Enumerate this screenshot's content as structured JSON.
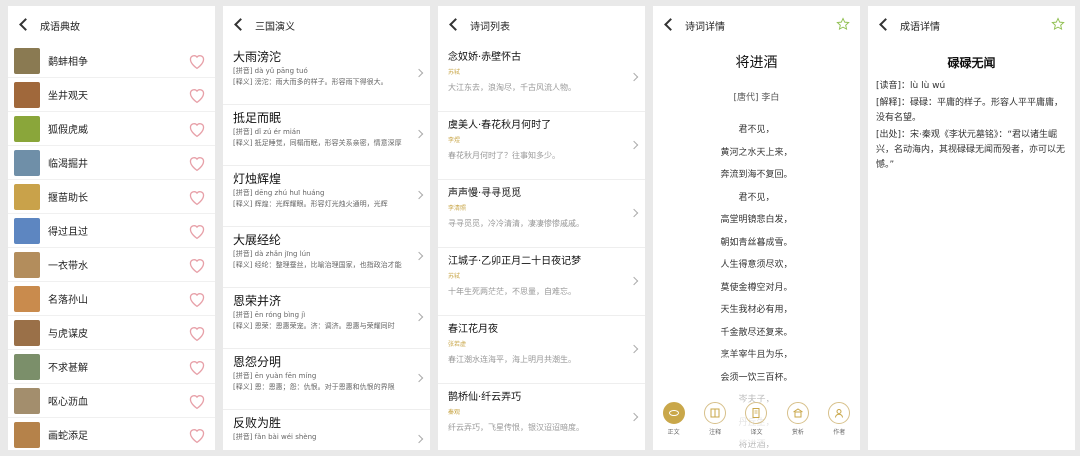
{
  "panel1": {
    "title": "成语典故",
    "items": [
      {
        "name": "鹬蚌相争",
        "color": "#8a7a52"
      },
      {
        "name": "坐井观天",
        "color": "#a0683b"
      },
      {
        "name": "狐假虎威",
        "color": "#8aa63a"
      },
      {
        "name": "临渴掘井",
        "color": "#6f8fa8"
      },
      {
        "name": "揠苗助长",
        "color": "#c9a24a"
      },
      {
        "name": "得过且过",
        "color": "#5d86c1"
      },
      {
        "name": "一衣带水",
        "color": "#b38d5c"
      },
      {
        "name": "名落孙山",
        "color": "#c98b4d"
      },
      {
        "name": "与虎谋皮",
        "color": "#9a7048"
      },
      {
        "name": "不求甚解",
        "color": "#7b8f6a"
      },
      {
        "name": "呕心沥血",
        "color": "#a38e6d"
      },
      {
        "name": "画蛇添足",
        "color": "#b5824a"
      }
    ]
  },
  "panel2": {
    "title": "三国演义",
    "items": [
      {
        "title": "大雨滂沱",
        "pinyin": "[拼音] dà yǔ pāng tuó",
        "meaning": "[释义] 滂沱：雨大而多的样子。形容雨下得很大。"
      },
      {
        "title": "抵足而眠",
        "pinyin": "[拼音] dǐ zú ér mián",
        "meaning": "[释义] 抵足睡觉，同榻而眠，形容关系亲密，情意深厚"
      },
      {
        "title": "灯烛辉煌",
        "pinyin": "[拼音] dēng zhú huī huáng",
        "meaning": "[释义] 辉煌：光辉耀眼。形容灯光烛火通明，光辉"
      },
      {
        "title": "大展经纶",
        "pinyin": "[拼音] dà zhǎn jīng lún",
        "meaning": "[释义] 经纶：整理蚕丝，比喻治理国家，也指政治才能"
      },
      {
        "title": "恩荣并济",
        "pinyin": "[拼音] ēn róng bìng jì",
        "meaning": "[释义] 恩荣：恩惠荣宠。济：调济。恩惠与荣耀同时"
      },
      {
        "title": "恩怨分明",
        "pinyin": "[拼音] ēn yuàn fēn míng",
        "meaning": "[释义] 恩：恩惠；怨：仇恨。对于恩惠和仇恨的界限"
      },
      {
        "title": "反败为胜",
        "pinyin": "[拼音] fǎn bài wéi shèng",
        "meaning": ""
      }
    ]
  },
  "panel3": {
    "title": "诗词列表",
    "items": [
      {
        "title": "念奴娇·赤壁怀古",
        "tag": "苏轼",
        "line": "大江东去，浪淘尽，千古风流人物。"
      },
      {
        "title": "虞美人·春花秋月何时了",
        "tag": "李煜",
        "line": "春花秋月何时了？往事知多少。"
      },
      {
        "title": "声声慢·寻寻觅觅",
        "tag": "李清照",
        "line": "寻寻觅觅，冷冷清清，凄凄惨惨戚戚。"
      },
      {
        "title": "江城子·乙卯正月二十日夜记梦",
        "tag": "苏轼",
        "line": "十年生死两茫茫，不思量，自难忘。"
      },
      {
        "title": "春江花月夜",
        "tag": "张若虚",
        "line": "春江潮水连海平，海上明月共潮生。"
      },
      {
        "title": "鹊桥仙·纤云弄巧",
        "tag": "秦观",
        "line": "纤云弄巧，飞星传恨，银汉迢迢暗度。"
      }
    ]
  },
  "panel4": {
    "title": "诗词详情",
    "poem_title": "将进酒",
    "author": "[唐代] 李白",
    "verses": [
      "君不见，",
      "黄河之水天上来，",
      "奔流到海不复回。",
      "君不见，",
      "高堂明镜悲白发，",
      "朝如青丝暮成雪。",
      "人生得意须尽欢，",
      "莫使金樽空对月。",
      "天生我材必有用，",
      "千金散尽还复来。",
      "烹羊宰牛且为乐，",
      "会须一饮三百杯。",
      "岑夫子，",
      "丹丘生，",
      "将进酒，"
    ],
    "tabs": [
      "正文",
      "注释",
      "译文",
      "赏析",
      "作者"
    ],
    "accent": "#c9a74a"
  },
  "panel5": {
    "title": "成语详情",
    "idiom": "碌碌无闻",
    "reading": "[读音]：lù lù wú",
    "meaning": "[解释]：碌碌：平庸的样子。形容人平平庸庸，没有名望。",
    "source": "[出处]：宋·秦观《李状元墓铭》：“君以诸生崛兴，名动海内，其视碌碌无闻而殁者，亦可以无憾。”"
  }
}
